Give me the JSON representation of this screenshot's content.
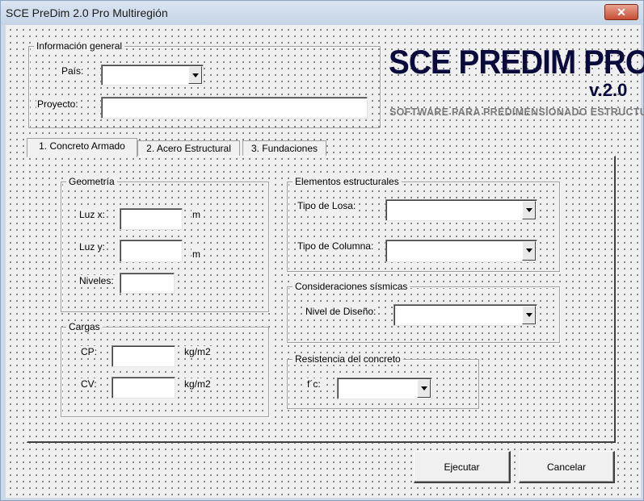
{
  "window": {
    "title": "SCE PreDim 2.0 Pro Multiregión",
    "close_glyph": "✕"
  },
  "general": {
    "label": "Información general",
    "pais_label": "País:",
    "pais_value": "",
    "proyecto_label": "Proyecto:",
    "proyecto_value": ""
  },
  "logo": {
    "title": "SCE PREDIM PRO",
    "version": "v.2.0",
    "subtitle": "SOFTWARE PARA PREDIMENSIONADO ESTRUCTURAL"
  },
  "tabs": [
    "1. Concreto Armado",
    "2. Acero Estructural",
    "3. Fundaciones"
  ],
  "geometria": {
    "label": "Geometría",
    "luz_x_label": "Luz x:",
    "luz_x_unit": "m",
    "luz_y_label": "Luz y:",
    "luz_y_unit": "m",
    "niveles_label": "Niveles:"
  },
  "cargas": {
    "label": "Cargas",
    "cp_label": "CP:",
    "cp_unit": "kg/m2",
    "cv_label": "CV:",
    "cv_unit": "kg/m2"
  },
  "elementos": {
    "label": "Elementos estructurales",
    "losa_label": "Tipo de Losa:",
    "columna_label": "Tipo de Columna:"
  },
  "sismicas": {
    "label": "Consideraciones sísmicas",
    "nivel_label": "Nivel de Diseño:"
  },
  "resistencia": {
    "label": "Resistencia del concreto",
    "fc_label": "f´c:"
  },
  "buttons": {
    "ejecutar": "Ejecutar",
    "cancelar": "Cancelar"
  },
  "colors": {
    "logo": "#0a0a3c",
    "subtitle": "#7a7a7a",
    "close": "#c74e34"
  }
}
